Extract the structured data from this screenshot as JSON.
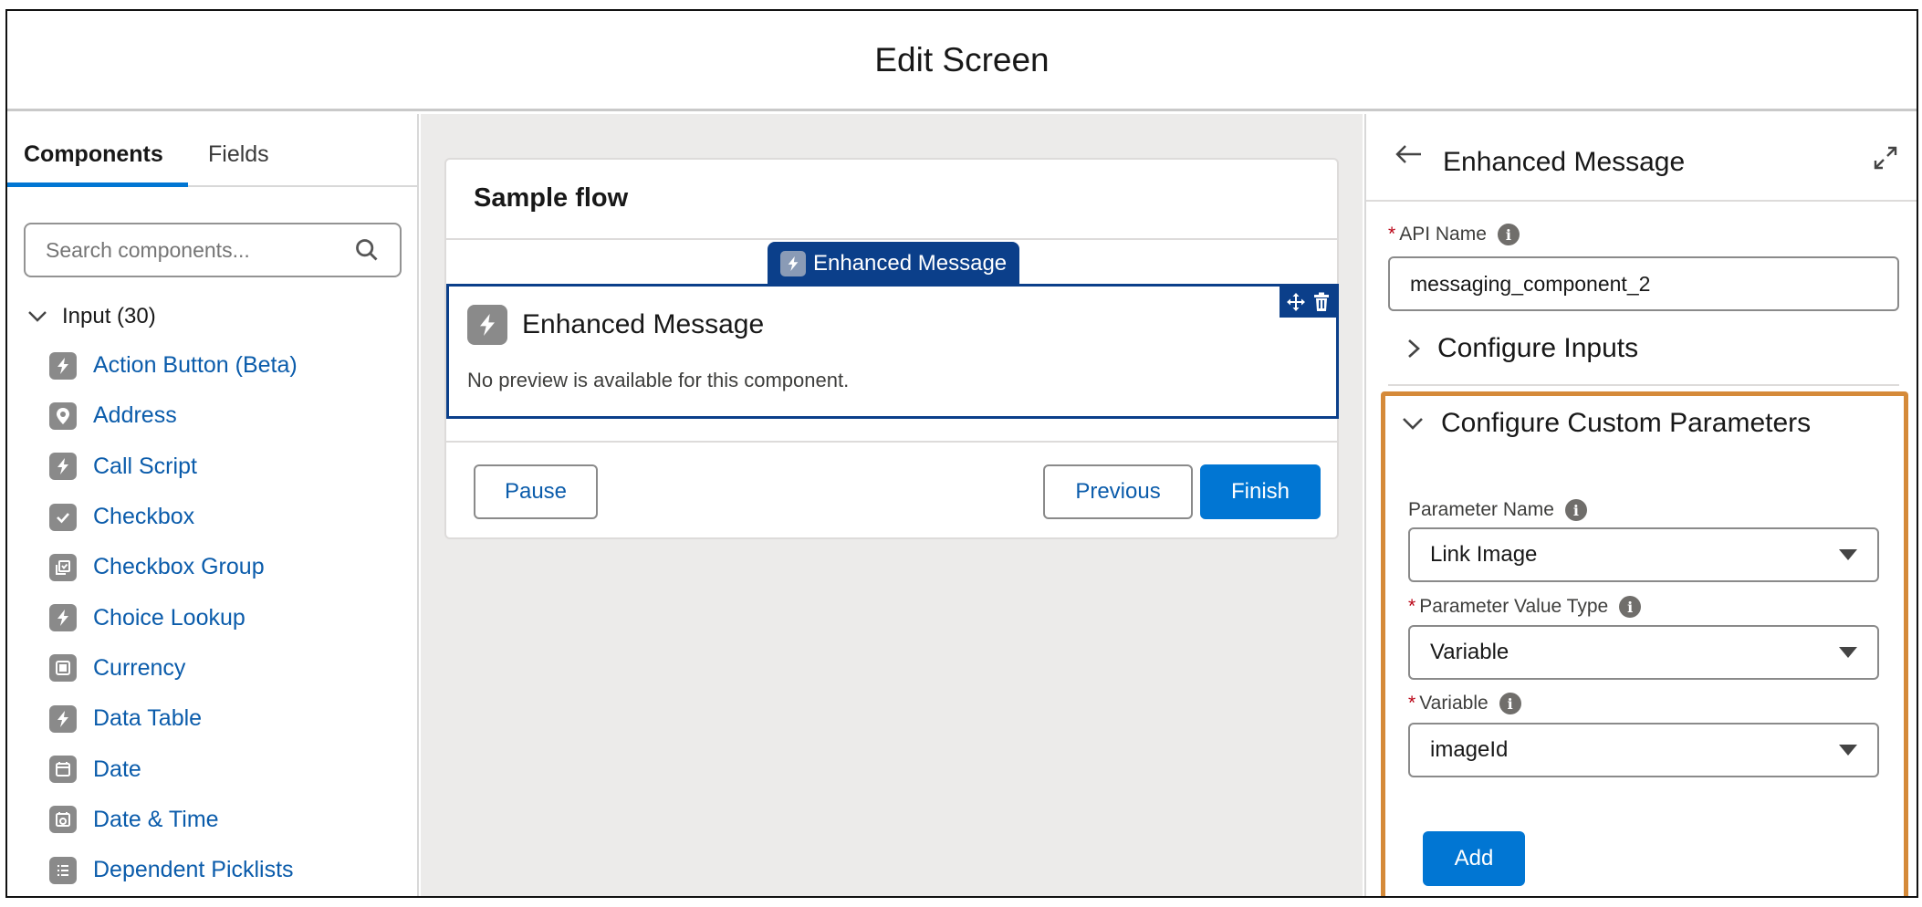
{
  "header": {
    "title": "Edit Screen"
  },
  "left_panel": {
    "tabs": [
      {
        "label": "Components",
        "active": true
      },
      {
        "label": "Fields",
        "active": false
      }
    ],
    "search": {
      "placeholder": "Search components...",
      "icon": "search-icon"
    },
    "group": {
      "label": "Input (30)",
      "expanded": true
    },
    "components": [
      {
        "label": "Action Button (Beta)",
        "icon": "lightning-icon"
      },
      {
        "label": "Address",
        "icon": "location-pin-icon"
      },
      {
        "label": "Call Script",
        "icon": "lightning-icon"
      },
      {
        "label": "Checkbox",
        "icon": "checkbox-icon"
      },
      {
        "label": "Checkbox Group",
        "icon": "checkbox-group-icon"
      },
      {
        "label": "Choice Lookup",
        "icon": "lightning-icon"
      },
      {
        "label": "Currency",
        "icon": "currency-icon"
      },
      {
        "label": "Data Table",
        "icon": "lightning-icon"
      },
      {
        "label": "Date",
        "icon": "calendar-icon"
      },
      {
        "label": "Date & Time",
        "icon": "calendar-clock-icon"
      },
      {
        "label": "Dependent Picklists",
        "icon": "list-icon"
      }
    ]
  },
  "canvas": {
    "card_title": "Sample flow",
    "chip_label": "Enhanced Message",
    "selected_component": {
      "title": "Enhanced Message",
      "note": "No preview is available for this component."
    },
    "buttons": {
      "pause": "Pause",
      "previous": "Previous",
      "finish": "Finish"
    }
  },
  "right_panel": {
    "title": "Enhanced Message",
    "api_name": {
      "label": "API Name",
      "required": "*",
      "value": "messaging_component_2"
    },
    "configure_inputs": {
      "label": "Configure Inputs",
      "expanded": false
    },
    "configure_custom_parameters": {
      "label": "Configure Custom Parameters",
      "expanded": true,
      "parameter_name": {
        "label": "Parameter Name",
        "value": "Link Image"
      },
      "parameter_value_type": {
        "label": "Parameter Value Type",
        "required": "*",
        "value": "Variable"
      },
      "variable": {
        "label": "Variable",
        "required": "*",
        "value": "imageId"
      },
      "add_label": "Add"
    },
    "info_glyph": "i"
  },
  "colors": {
    "brand": "#0176d3",
    "link": "#0b5cab",
    "selection": "#0b3f8a",
    "highlight": "#d58a39",
    "required": "#ba0517"
  }
}
